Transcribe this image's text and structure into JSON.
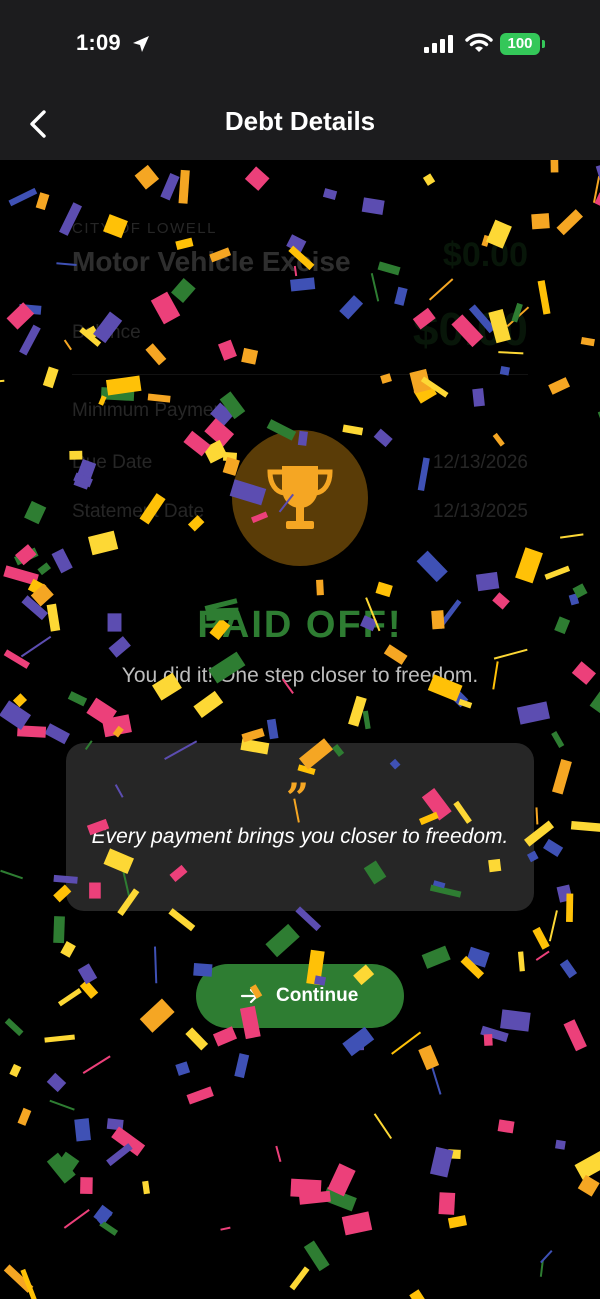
{
  "status_bar": {
    "time": "1:09",
    "battery": "100",
    "battery_color": "#34c759"
  },
  "header": {
    "title": "Debt Details",
    "back_icon": "chevron-left-icon"
  },
  "background": {
    "issuer": "CITY OF LOWELL",
    "debt_name": "Motor Vehicle Excise",
    "top_amount": "$0.00",
    "balance_label": "Balance",
    "balance_amount": "$0.00",
    "minimum_payment_label": "Minimum Payment",
    "due_date_label": "Due Date",
    "due_date_value": "12/13/2026",
    "statement_date_label": "Statement Date",
    "statement_date_value": "12/13/2025"
  },
  "celebration": {
    "icon": "trophy-icon",
    "title": "PAID OFF!",
    "subtitle": "You did it! One step closer to freedom.",
    "quote_icon": "quote-icon",
    "quote_mark": "”",
    "quote": "Every payment brings you closer to freedom.",
    "continue_label": "Continue",
    "continue_icon": "arrow-right-icon"
  },
  "colors": {
    "accent_green": "#2e7d32",
    "trophy_gold": "#f5a623",
    "confetti": [
      "#fdd835",
      "#f5a623",
      "#2e7d32",
      "#ec407a",
      "#5c4db1",
      "#3f51b5",
      "#ffc107"
    ]
  }
}
